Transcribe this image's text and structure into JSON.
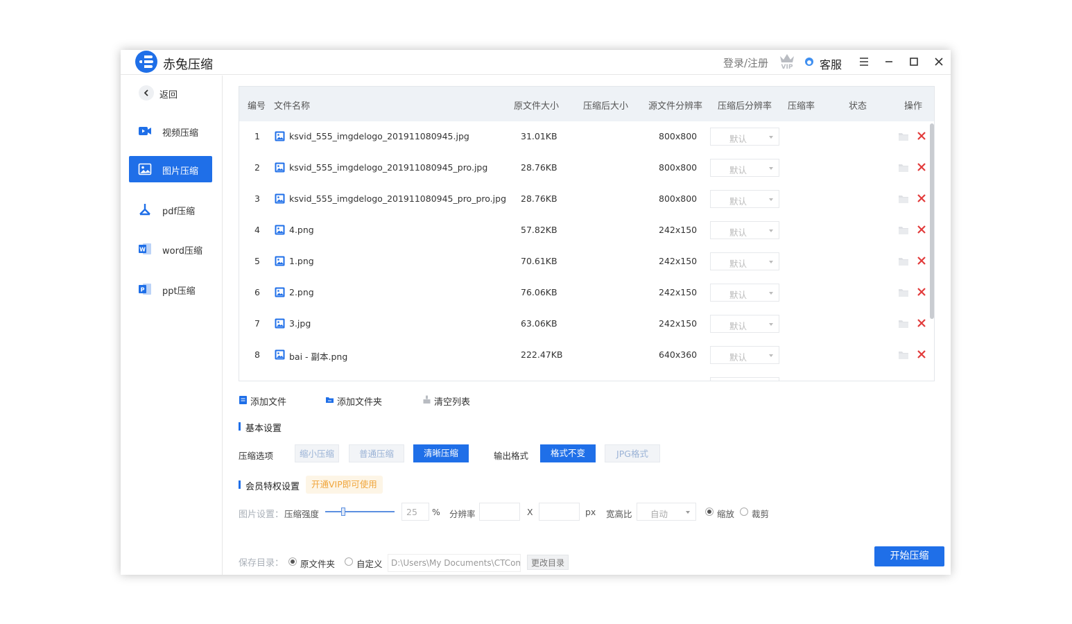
{
  "app": {
    "title": "赤兔压缩",
    "login": "登录/注册",
    "service": "客服"
  },
  "sidebar": {
    "back": "返回",
    "items": [
      {
        "label": "视频压缩",
        "icon": "video-icon"
      },
      {
        "label": "图片压缩",
        "icon": "image-icon"
      },
      {
        "label": "pdf压缩",
        "icon": "pdf-icon"
      },
      {
        "label": "word压缩",
        "icon": "word-icon"
      },
      {
        "label": "ppt压缩",
        "icon": "ppt-icon"
      }
    ]
  },
  "table": {
    "headers": [
      "编号",
      "文件名称",
      "原文件大小",
      "压缩后大小",
      "源文件分辨率",
      "压缩后分辨率",
      "压缩率",
      "状态",
      "操作"
    ],
    "select_default": "默认",
    "rows": [
      {
        "no": "1",
        "name": "ksvid_555_imgdelogo_201911080945.jpg",
        "size": "31.01KB",
        "res": "800x800"
      },
      {
        "no": "2",
        "name": "ksvid_555_imgdelogo_201911080945_pro.jpg",
        "size": "28.76KB",
        "res": "800x800"
      },
      {
        "no": "3",
        "name": "ksvid_555_imgdelogo_201911080945_pro_pro.jpg",
        "size": "28.76KB",
        "res": "800x800"
      },
      {
        "no": "4",
        "name": "4.png",
        "size": "57.82KB",
        "res": "242x150"
      },
      {
        "no": "5",
        "name": "1.png",
        "size": "70.61KB",
        "res": "242x150"
      },
      {
        "no": "6",
        "name": "2.png",
        "size": "76.06KB",
        "res": "242x150"
      },
      {
        "no": "7",
        "name": "3.jpg",
        "size": "63.06KB",
        "res": "242x150"
      },
      {
        "no": "8",
        "name": "bai - 副本.png",
        "size": "222.47KB",
        "res": "640x360"
      }
    ]
  },
  "actions": {
    "add_file": "添加文件",
    "add_folder": "添加文件夹",
    "clear_list": "清空列表"
  },
  "basic": {
    "title": "基本设置",
    "compress_label": "压缩选项",
    "compress_options": [
      "缩小压缩",
      "普通压缩",
      "清晰压缩"
    ],
    "format_label": "输出格式",
    "format_options": [
      "格式不变",
      "JPG格式"
    ]
  },
  "vip": {
    "title": "会员特权设置",
    "badge": "开通VIP即可使用",
    "image_settings": "图片设置：",
    "strength_label": "压缩强度",
    "strength_value": "25",
    "percent": "%",
    "resolution_label": "分辨率",
    "x": "X",
    "px": "px",
    "ratio_label": "宽高比",
    "ratio_value": "自动",
    "scale": "缩放",
    "crop": "裁剪"
  },
  "save": {
    "label": "保存目录：",
    "original": "原文件夹",
    "custom": "自定义",
    "path": "D:\\Users\\My Documents\\CTCompr",
    "change": "更改目录"
  },
  "start": "开始压缩",
  "colors": {
    "accent": "#1f6fe8",
    "delete": "#e23b3b",
    "vip": "#f0a53b"
  }
}
